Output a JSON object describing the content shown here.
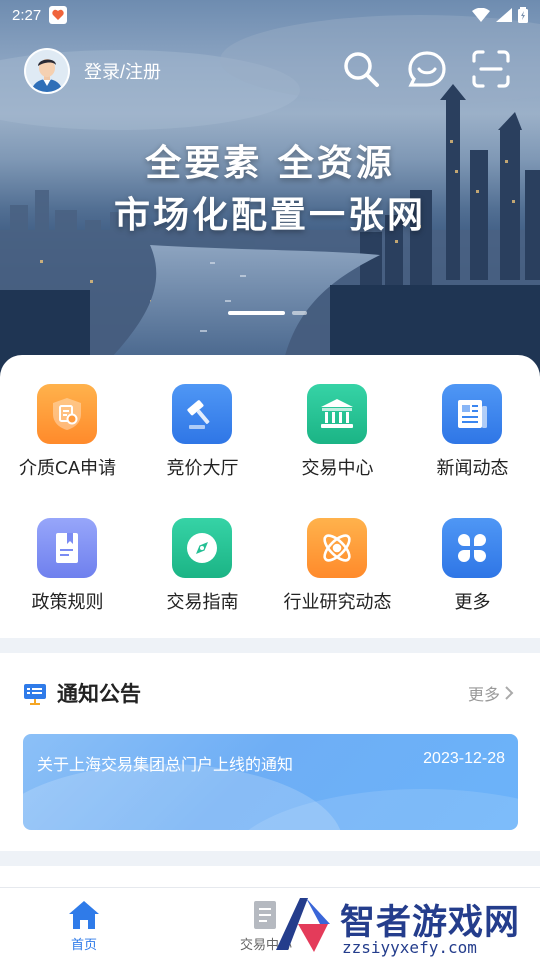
{
  "status_bar": {
    "time": "2:27"
  },
  "header": {
    "login_label": "登录/注册"
  },
  "banner": {
    "slogan_line1": "全要素 全资源",
    "slogan_line2": "市场化配置一张网",
    "slide_count": 2,
    "active_slide": 1
  },
  "menu": {
    "items": [
      {
        "label": "介质CA申请",
        "icon": "ca-shield-icon",
        "color": "#ff9a3c"
      },
      {
        "label": "竞价大厅",
        "icon": "gavel-icon",
        "color": "#3b86f0"
      },
      {
        "label": "交易中心",
        "icon": "bank-icon",
        "color": "#24c196"
      },
      {
        "label": "新闻动态",
        "icon": "newspaper-icon",
        "color": "#3b86f0"
      },
      {
        "label": "政策规则",
        "icon": "book-icon",
        "color": "#7b8cf3"
      },
      {
        "label": "交易指南",
        "icon": "compass-icon",
        "color": "#26c095"
      },
      {
        "label": "行业研究动态",
        "icon": "atom-icon",
        "color": "#ff9a3c"
      },
      {
        "label": "更多",
        "icon": "more-grid-icon",
        "color": "#3b86f0"
      }
    ]
  },
  "notice": {
    "title": "通知公告",
    "more_label": "更多",
    "items": [
      {
        "text": "关于上海交易集团总门户上线的通知",
        "date": "2023-12-28"
      }
    ]
  },
  "bottom_nav": {
    "items": [
      {
        "label": "首页",
        "icon": "home-icon",
        "active": true
      },
      {
        "label": "交易中心",
        "icon": "document-icon",
        "active": false
      }
    ]
  },
  "watermark": {
    "brand": "智者游戏网",
    "url": "zzsiyyxefy.com"
  },
  "colors": {
    "accent": "#2f7be9",
    "banner_notice": "#74b2f7"
  }
}
